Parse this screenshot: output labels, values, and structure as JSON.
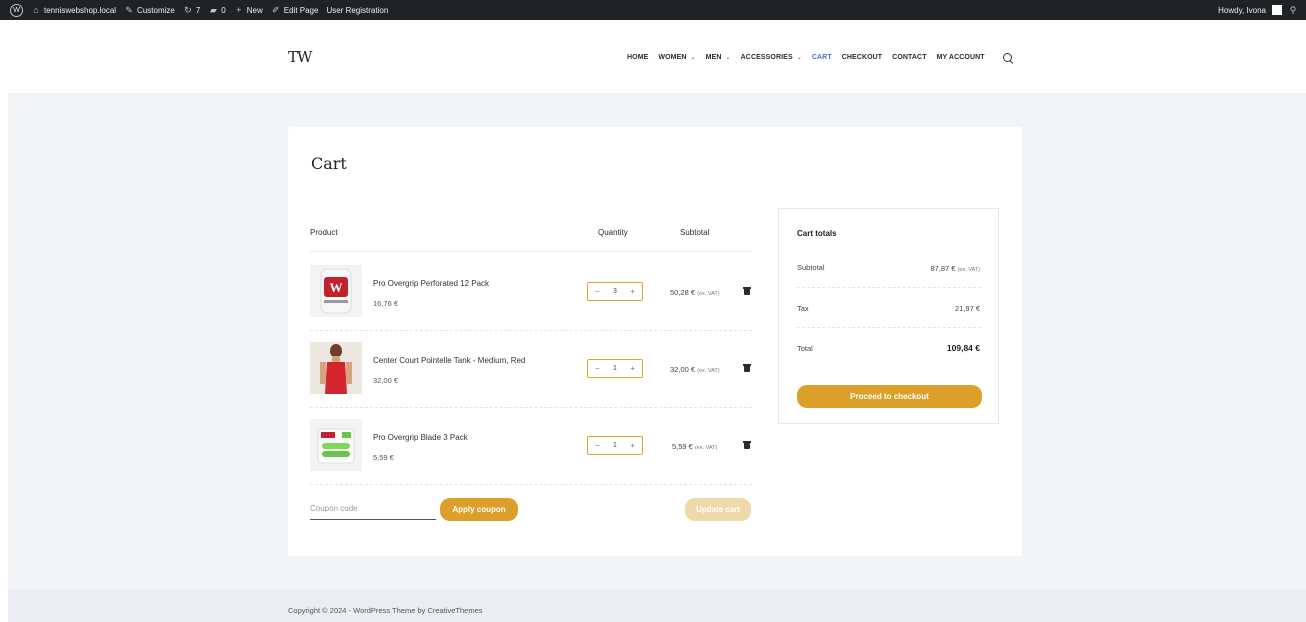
{
  "admin_bar": {
    "site": "tenniswebshop.local",
    "customize": "Customize",
    "updates_count": "7",
    "comments_count": "0",
    "new": "New",
    "edit_page": "Edit Page",
    "user_registration": "User Registration",
    "howdy": "Howdy, Ivona"
  },
  "header": {
    "logo": "TW",
    "nav": [
      {
        "label": "HOME",
        "dropdown": false
      },
      {
        "label": "WOMEN",
        "dropdown": true
      },
      {
        "label": "MEN",
        "dropdown": true
      },
      {
        "label": "ACCESSORIES",
        "dropdown": true
      },
      {
        "label": "CART",
        "dropdown": false,
        "active": true
      },
      {
        "label": "CHECKOUT",
        "dropdown": false
      },
      {
        "label": "CONTACT",
        "dropdown": false
      },
      {
        "label": "MY ACCOUNT",
        "dropdown": false
      }
    ],
    "active_color": "#4a72c4"
  },
  "cart": {
    "title": "Cart",
    "columns": {
      "product": "Product",
      "quantity": "Quantity",
      "subtotal": "Subtotal"
    },
    "items": [
      {
        "name": "Pro Overgrip Perforated 12 Pack",
        "price": "16,76 €",
        "quantity": "3",
        "subtotal": "50,28 €",
        "vat_note": "(ex. VAT)"
      },
      {
        "name": "Center Court Pointelle Tank - Medium, Red",
        "price": "32,00 €",
        "quantity": "1",
        "subtotal": "32,00 €",
        "vat_note": "(ex. VAT)"
      },
      {
        "name": "Pro Overgrip Blade 3 Pack",
        "price": "5,59 €",
        "quantity": "1",
        "subtotal": "5,59 €",
        "vat_note": "(ex. VAT)"
      }
    ],
    "coupon_placeholder": "Coupon code",
    "apply_coupon": "Apply coupon",
    "update_cart": "Update cart",
    "qty_minus": "−",
    "qty_plus": "+"
  },
  "totals": {
    "title": "Cart totals",
    "subtotal_label": "Subtotal",
    "subtotal_value": "87,87 €",
    "subtotal_vat": "(ex. VAT)",
    "tax_label": "Tax",
    "tax_value": "21,97 €",
    "total_label": "Total",
    "total_value": "109,84 €",
    "checkout_button": "Proceed to checkout"
  },
  "footer": {
    "text": "Copyright © 2024 - WordPress Theme by CreativeThemes"
  },
  "colors": {
    "accent": "#dca02a",
    "accent_disabled": "#eed9a9",
    "admin_bar": "#1d2327",
    "page_bg": "#f2f5f8"
  }
}
